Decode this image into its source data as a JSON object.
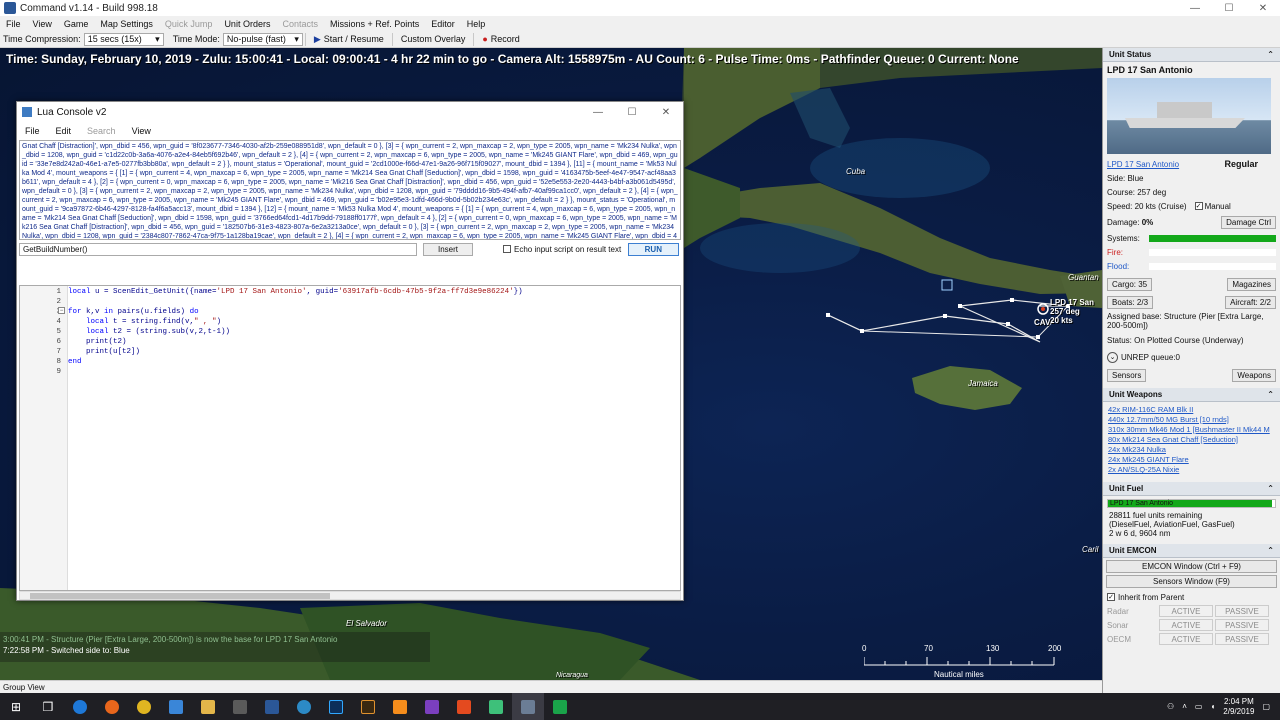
{
  "window": {
    "title": "Command v1.14 - Build 998.18",
    "min": "—",
    "max": "☐",
    "close": "✕"
  },
  "menu": {
    "items": [
      "File",
      "View",
      "Game",
      "Map Settings",
      "Quick Jump",
      "Unit Orders",
      "Contacts",
      "Missions + Ref. Points",
      "Editor",
      "Help"
    ]
  },
  "toolbar": {
    "time_compression_label": "Time Compression:",
    "time_compression_value": "15 secs (15x)",
    "time_mode_label": "Time Mode:",
    "time_mode_value": "No-pulse (fast)",
    "start_resume": "Start / Resume",
    "custom_overlay": "Custom Overlay",
    "record": "Record"
  },
  "map": {
    "status_line": "Time: Sunday, February 10, 2019 - Zulu: 15:00:41 - Local: 09:00:41 - 4 hr 22 min to go -  Camera Alt: 1558975m - AU Count: 6 - Pulse Time: 0ms - Pathfinder Queue: 0 Current: None",
    "labels": {
      "cuba": "Cuba",
      "jamaica": "Jamaica",
      "el_salvador": "El Salvador",
      "nicaragua": "Nicaragua",
      "guantanamo": "Guantan",
      "caribbean": "Caril"
    },
    "unit_label": {
      "line1": "LPD 17 San",
      "line2": "257 deg",
      "line3": "20 kts",
      "cav": "CAV"
    },
    "messages": [
      "3:00:41 PM - Structure (Pier [Extra Large, 200-500m]) is now the base for LPD 17 San Antonio",
      "7:22:58 PM - Switched side to: Blue"
    ],
    "scale": {
      "ticks": [
        "0",
        "70",
        "130",
        "200"
      ],
      "unit": "Nautical miles"
    }
  },
  "statusbar": {
    "text": "Group View"
  },
  "lua": {
    "title": "Lua Console v2",
    "menu": [
      "File",
      "Edit",
      "Search",
      "View"
    ],
    "output": "Gnat Chaff [Distraction]', wpn_dbid = 456, wpn_guid = '8f023677-7346-4030-af2b-259e088951d8', wpn_default = 0 }, [3] = { wpn_current = 2, wpn_maxcap = 2, wpn_type = 2005, wpn_name = 'Mk234 Nulka', wpn_dbid = 1208, wpn_guid = 'c1d22c0b-3a6a-4076-a2e4-84eb5f692b46', wpn_default = 2 }, [4] = { wpn_current = 2, wpn_maxcap = 6, wpn_type = 2005, wpn_name = 'Mk245 GIANT Flare', wpn_dbid = 469, wpn_guid = '33e7e8d242a0-46e1-a7e5-0277fb3bb80a', wpn_default = 2 } }, mount_status = 'Operational', mount_guid = '2cd1000e-f66d-47e1-9a26-96f715f09027', mount_dbid = 1394 }, [11] = { mount_name = 'Mk53 Nulka Mod 4', mount_weapons = { [1] = { wpn_current = 4, wpn_maxcap = 6, wpn_type = 2005, wpn_name = 'Mk214 Sea Gnat Chaff [Seduction]', wpn_dbid = 1598, wpn_guid = '4163475b-5eef-4e47-9547-acf48aa3b611', wpn_default = 4 }, [2] = { wpn_current = 0, wpn_maxcap = 6, wpn_type = 2005, wpn_name = 'Mk216 Sea Gnat Chaff [Distraction]', wpn_dbid = 456, wpn_guid = '52e5e553-2e20-4443-b4bf-a3b061d5495d', wpn_default = 0 }, [3] = { wpn_current = 2, wpn_maxcap = 2, wpn_type = 2005, wpn_name = 'Mk234 Nulka', wpn_dbid = 1208, wpn_guid = '79dddd16-9b5-494f-afb7-40af99ca1cc0', wpn_default = 2 }, [4] = { wpn_current = 2, wpn_maxcap = 6, wpn_type = 2005, wpn_name = 'Mk245 GIANT Flare', wpn_dbid = 469, wpn_guid = 'b02e95e3-1dfd-466d-9b0d-5b02b234e63c', wpn_default = 2 } }, mount_status = 'Operational', mount_guid = '9ca97872-6b46-4297-8128-fa4f6a5acc13', mount_dbid = 1394 }, [12] = { mount_name = 'Mk53 Nulka Mod 4', mount_weapons = { [1] = { wpn_current = 4, wpn_maxcap = 6, wpn_type = 2005, wpn_name = 'Mk214 Sea Gnat Chaff [Seduction]', wpn_dbid = 1598, wpn_guid = '3766ed64fcd1-4d17b9dd-79188ff0177f', wpn_default = 4 }, [2] = { wpn_current = 0, wpn_maxcap = 6, wpn_type = 2005, wpn_name = 'Mk216 Sea Gnat Chaff [Distraction]', wpn_dbid = 456, wpn_guid = '182507b6-31e3-4823-807a-6e2a3213a0ce', wpn_default = 0 }, [3] = { wpn_current = 2, wpn_maxcap = 2, wpn_type = 2005, wpn_name = 'Mk234 Nulka', wpn_dbid = 1208, wpn_guid = '2384c807-7862-47ca-9f75-1a128ba19cae', wpn_default = 2 }, [4] = { wpn_current = 2, wpn_maxcap = 6, wpn_type = 2005, wpn_name = 'Mk245 GIANT Flare', wpn_dbid = 469, wpn_guid = '5f4e19db-3788-4327-8d63-51d18627388a', wpn_default = 2 } }, mount_status = 'Operational', mount_guid = '825d1e6a-a10c-4b6c-ac62-0589b2538198', mount_dbid = 1394 }, [13] = { mount_name = 'Mk53 Nulka Mod 4', mount_weapons = { [1] = { wpn_current = 4, wpn_maxcap = 6,",
    "command": "GetBuildNumber()",
    "insert": "Insert",
    "echo": "Echo input script on result text",
    "run": "RUN",
    "line_numbers": [
      "1",
      "2",
      "3",
      "4",
      "5",
      "6",
      "7",
      "8",
      "9"
    ]
  },
  "panel": {
    "unit_status_title": "Unit Status",
    "unit_name": "LPD 17 San Antonio",
    "unit_link": "LPD 17 San Antonio",
    "proficiency": "Regular",
    "side": "Side: Blue",
    "course": "Course: 257 deg",
    "speed": "Speed: 20 kts (Cruise)",
    "manual": "Manual",
    "damage": "Damage:",
    "damage_value": "0%",
    "damage_ctrl": "Damage Ctrl",
    "systems": "Systems:",
    "fire": "Fire:",
    "flood": "Flood:",
    "cargo": "Cargo: 35",
    "magazines": "Magazines",
    "boats": "Boats: 2/3",
    "aircraft": "Aircraft: 2/2",
    "assigned_base": "Assigned base: Structure (Pier [Extra Large, 200-500m])",
    "status": "Status: On Plotted Course (Underway)",
    "unrep": "UNREP queue:0",
    "sensors": "Sensors",
    "weapons": "Weapons",
    "unit_weapons_title": "Unit Weapons",
    "weapons_list": [
      "42x RIM-116C RAM Blk II",
      "440x 12.7mm/50 MG Burst [10 rnds]",
      "310x 30mm Mk46 Mod 1 [Bushmaster II Mk44 M",
      "80x Mk214 Sea Gnat Chaff [Seduction]",
      "24x Mk234 Nulka",
      "24x Mk245 GIANT Flare",
      "2x AN/SLQ-25A Nixie"
    ],
    "unit_fuel_title": "Unit Fuel",
    "fuel_bar_label": "LPD 17 San Antonio",
    "fuel_remaining": "28811 fuel units remaining",
    "fuel_types": "(DieselFuel, AviationFuel, GasFuel)",
    "fuel_endurance": "2 w 6 d, 9604 nm",
    "fuel_level": 0.98,
    "unit_emcon_title": "Unit EMCON",
    "emcon_window": "EMCON Window (Ctrl + F9)",
    "sensors_window": "Sensors Window (F9)",
    "inherit": "Inherit from Parent",
    "emcon_rows": [
      {
        "name": "Radar",
        "active": "ACTIVE",
        "passive": "PASSIVE"
      },
      {
        "name": "Sonar",
        "active": "ACTIVE",
        "passive": "PASSIVE"
      },
      {
        "name": "OECM",
        "active": "ACTIVE",
        "passive": "PASSIVE"
      }
    ]
  },
  "taskbar": {
    "time": "2:04 PM",
    "date": "2/9/2019"
  }
}
